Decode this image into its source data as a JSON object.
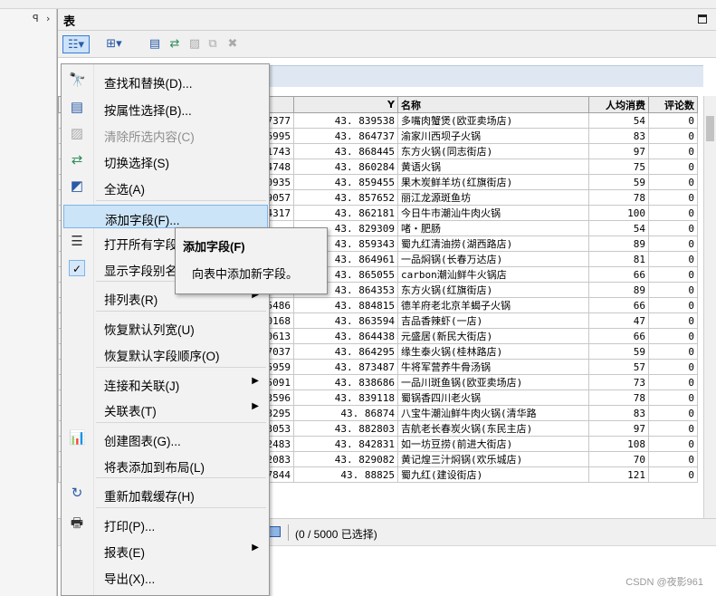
{
  "window": {
    "title": "表"
  },
  "status": {
    "text": "(0 / 5000 已选择)"
  },
  "watermark": "CSDN @夜影961",
  "grid": {
    "headers": {
      "y": "Y",
      "name": "名称",
      "avg": "人均消费",
      "reviews": "评论数"
    },
    "rows": [
      {
        "id": "37377",
        "y": "43. 839538",
        "name": "多嘴肉蟹煲(欧亚卖场店)",
        "avg": "54",
        "reviews": "0"
      },
      {
        "id": "16995",
        "y": "43. 864737",
        "name": "渝家川西坝子火锅",
        "avg": "83",
        "reviews": "0"
      },
      {
        "id": "11743",
        "y": "43. 868445",
        "name": "东方火锅(同志街店)",
        "avg": "97",
        "reviews": "0"
      },
      {
        "id": "34748",
        "y": "43. 860284",
        "name": "黄语火锅",
        "avg": "75",
        "reviews": "0"
      },
      {
        "id": "30935",
        "y": "43. 859455",
        "name": "果木炭鲜羊坊(红旗街店)",
        "avg": "59",
        "reviews": "0"
      },
      {
        "id": "39057",
        "y": "43. 857652",
        "name": "丽江龙源斑鱼坊",
        "avg": "78",
        "reviews": "0"
      },
      {
        "id": "04317",
        "y": "43. 862181",
        "name": "今日牛市潮汕牛肉火锅",
        "avg": "100",
        "reviews": "0"
      },
      {
        "id": "",
        "y": "43. 829309",
        "name": "啫・肥肠",
        "avg": "54",
        "reviews": "0"
      },
      {
        "id": "",
        "y": "43. 859343",
        "name": "蜀九红清油捞(湖西路店)",
        "avg": "89",
        "reviews": "0"
      },
      {
        "id": "",
        "y": "43. 864961",
        "name": "一品焖锅(长春万达店)",
        "avg": "81",
        "reviews": "0"
      },
      {
        "id": "",
        "y": "43. 865055",
        "name": "carbon潮汕鲜牛火锅店",
        "avg": "66",
        "reviews": "0"
      },
      {
        "id": "38218",
        "y": "43. 864353",
        "name": "东方火锅(红旗街店)",
        "avg": "89",
        "reviews": "0"
      },
      {
        "id": "95486",
        "y": "43. 884815",
        "name": "德羊府老北京羊蝎子火锅",
        "avg": "66",
        "reviews": "0"
      },
      {
        "id": "90168",
        "y": "43. 863594",
        "name": "吉品香辣虾(一店)",
        "avg": "47",
        "reviews": "0"
      },
      {
        "id": "00613",
        "y": "43. 864438",
        "name": "元盛居(新民大街店)",
        "avg": "66",
        "reviews": "0"
      },
      {
        "id": "07037",
        "y": "43. 864295",
        "name": "缘生泰火锅(桂林路店)",
        "avg": "59",
        "reviews": "0"
      },
      {
        "id": "15959",
        "y": "43. 873487",
        "name": "牛将军营养牛骨汤锅",
        "avg": "57",
        "reviews": "0"
      },
      {
        "id": "35091",
        "y": "43. 838686",
        "name": "一品川斑鱼锅(欧亚卖场店)",
        "avg": "73",
        "reviews": "0"
      },
      {
        "id": "23596",
        "y": "43. 839118",
        "name": "蜀锅香四川老火锅",
        "avg": "78",
        "reviews": "0"
      },
      {
        "id": "13295",
        "y": "43. 86874",
        "name": "八宝牛潮汕鲜牛肉火锅(清华路",
        "avg": "83",
        "reviews": "0"
      },
      {
        "id": "03053",
        "y": "43. 882803",
        "name": "吉航老长春炭火锅(东民主店)",
        "avg": "97",
        "reviews": "0"
      },
      {
        "id": "32483",
        "y": "43. 842831",
        "name": "如一坊豆捞(前进大街店)",
        "avg": "108",
        "reviews": "0"
      },
      {
        "id": "32083",
        "y": "43. 829082",
        "name": "黄记煌三汁焖锅(欢乐城店)",
        "avg": "70",
        "reviews": "0"
      },
      {
        "id": "37844",
        "y": "43. 88825",
        "name": "蜀九红(建设街店)",
        "avg": "121",
        "reviews": "0"
      }
    ]
  },
  "menu": {
    "items": [
      {
        "icon": "binoculars-icon",
        "glyph": "🔭",
        "label": "查找和替换(D)..."
      },
      {
        "icon": "select-by-attributes-icon",
        "glyph": "▤",
        "label": "按属性选择(B)..."
      },
      {
        "icon": "clear-selection-icon",
        "glyph": "▨",
        "label": "清除所选内容(C)",
        "disabled": true
      },
      {
        "icon": "switch-selection-icon",
        "glyph": "⇄",
        "label": "切换选择(S)"
      },
      {
        "icon": "select-all-icon",
        "glyph": "◩",
        "label": "全选(A)"
      },
      {
        "icon": "",
        "glyph": "",
        "label": "添加字段(F)...",
        "hover": true
      },
      {
        "icon": "show-fields-icon",
        "glyph": "☰",
        "label": "打开所有字段"
      },
      {
        "icon": "check-icon",
        "glyph": "✓",
        "label": "显示字段别名",
        "checked": true
      },
      {
        "icon": "",
        "glyph": "",
        "label": "排列表(R)",
        "submenu": true
      },
      {
        "icon": "",
        "glyph": "",
        "label": "恢复默认列宽(U)"
      },
      {
        "icon": "",
        "glyph": "",
        "label": "恢复默认字段顺序(O)"
      },
      {
        "icon": "",
        "glyph": "",
        "label": "连接和关联(J)",
        "submenu": true
      },
      {
        "icon": "",
        "glyph": "",
        "label": "关联表(T)",
        "submenu": true
      },
      {
        "icon": "bar-chart-icon",
        "glyph": "📊",
        "label": "创建图表(G)..."
      },
      {
        "icon": "",
        "glyph": "",
        "label": "将表添加到布局(L)"
      },
      {
        "icon": "reload-icon",
        "glyph": "↻",
        "label": "重新加载缓存(H)"
      },
      {
        "icon": "printer-icon",
        "glyph": "🖶",
        "label": "打印(P)..."
      },
      {
        "icon": "",
        "glyph": "",
        "label": "报表(E)",
        "submenu": true
      },
      {
        "icon": "",
        "glyph": "",
        "label": "导出(X)..."
      }
    ]
  },
  "tooltip": {
    "title": "添加字段(F)",
    "description": "向表中添加新字段。"
  }
}
